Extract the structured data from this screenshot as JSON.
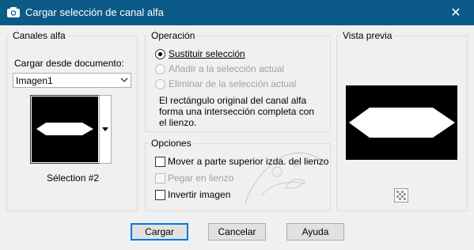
{
  "window": {
    "title": "Cargar selección de canal alfa",
    "close_glyph": "✕"
  },
  "alpha_channels": {
    "group_label": "Canales alfa",
    "load_from_label": "Cargar desde documento:",
    "document_selected": "Imagen1",
    "thumbnail_caption": "Sélection #2"
  },
  "operation": {
    "group_label": "Operación",
    "options": [
      {
        "label": "Sustituir selección",
        "selected": true,
        "enabled": true
      },
      {
        "label": "Añadir a la selección actual",
        "selected": false,
        "enabled": false
      },
      {
        "label": "Eliminar de la selección actual",
        "selected": false,
        "enabled": false
      }
    ],
    "description_lines": [
      "El rectángulo original del canal alfa",
      "forma una intersección completa con",
      "el lienzo."
    ]
  },
  "options": {
    "group_label": "Opciones",
    "checkboxes": [
      {
        "label": "Mover a parte superior izda. del lienzo",
        "checked": false,
        "enabled": true
      },
      {
        "label": "Pegar en lienzo",
        "checked": false,
        "enabled": false
      },
      {
        "label": "Invertir imagen",
        "checked": false,
        "enabled": true
      }
    ]
  },
  "preview": {
    "group_label": "Vista previa",
    "checker_icon": "transparency-checker-icon"
  },
  "buttons": {
    "load": "Cargar",
    "cancel": "Cancelar",
    "help": "Ayuda"
  },
  "colors": {
    "titlebar": "#0c5a87",
    "accent": "#0078d7"
  }
}
